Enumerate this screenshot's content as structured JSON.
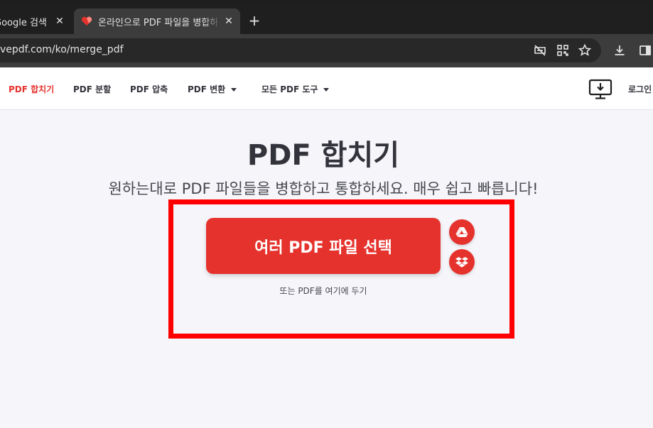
{
  "browser": {
    "tabs": [
      {
        "title": "Google 검색",
        "close": "✕"
      },
      {
        "title": "온라인으로 PDF 파일을 병합하",
        "close": "✕"
      }
    ],
    "new_tab": "+",
    "url": "vepdf.com/ko/merge_pdf"
  },
  "site": {
    "nav": [
      {
        "label": "PDF 합치기"
      },
      {
        "label": "PDF 분할"
      },
      {
        "label": "PDF 압축"
      },
      {
        "label": "PDF 변환"
      },
      {
        "label": "모든 PDF 도구"
      }
    ],
    "login": "로그인"
  },
  "main": {
    "title": "PDF 합치기",
    "subtitle": "원하는대로 PDF 파일들을 병합하고 통합하세요. 매우 쉽고 빠릅니다!",
    "select_button": "여러 PDF 파일 선택",
    "drop_hint": "또는 PDF를 여기에 두기",
    "cloud_icons": [
      "google-drive-icon",
      "dropbox-icon"
    ]
  },
  "colors": {
    "brand_red": "#e5322d",
    "highlight_box": "#ff0000"
  }
}
